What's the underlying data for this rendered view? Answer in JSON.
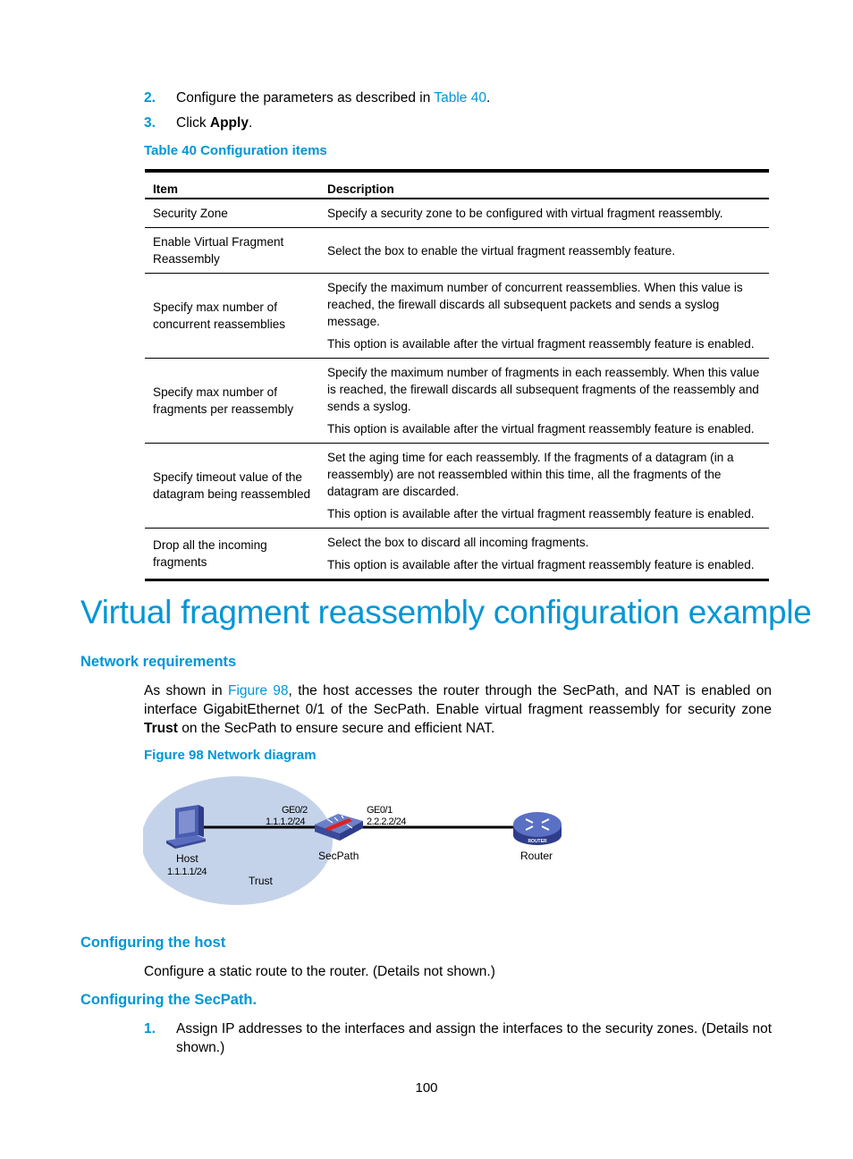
{
  "steps_top": [
    {
      "num": "2.",
      "text_before": "Configure the parameters as described in ",
      "link": "Table 40",
      "text_after": "."
    },
    {
      "num": "3.",
      "text_before": "Click ",
      "bold": "Apply",
      "text_after": "."
    }
  ],
  "table": {
    "caption": "Table 40 Configuration items",
    "headers": [
      "Item",
      "Description"
    ],
    "rows": [
      {
        "item": "Security Zone",
        "desc": [
          "Specify a security zone to be configured with virtual fragment reassembly."
        ]
      },
      {
        "item": "Enable Virtual Fragment Reassembly",
        "desc": [
          "Select the box to enable the virtual fragment reassembly feature."
        ]
      },
      {
        "item": "Specify max number of concurrent reassemblies",
        "desc": [
          "Specify the maximum number of concurrent reassemblies. When this value is reached, the firewall discards all subsequent packets and sends a syslog message.",
          "This option is available after the virtual fragment reassembly feature is enabled."
        ]
      },
      {
        "item": "Specify max number of fragments per reassembly",
        "desc": [
          "Specify the maximum number of fragments in each reassembly. When this value is reached, the firewall discards all subsequent fragments of the reassembly and sends a syslog.",
          "This option is available after the virtual fragment reassembly feature is enabled."
        ]
      },
      {
        "item": "Specify timeout value of the datagram being reassembled",
        "desc": [
          "Set the aging time for each reassembly. If the fragments of a datagram (in a reassembly) are not reassembled within this time, all the fragments of the datagram are discarded.",
          "This option is available after the virtual fragment reassembly feature is enabled."
        ]
      },
      {
        "item": "Drop all the incoming fragments",
        "desc": [
          "Select the box to discard all incoming fragments.",
          "This option is available after the virtual fragment reassembly feature is enabled."
        ]
      }
    ]
  },
  "section_title": "Virtual fragment reassembly configuration example",
  "network_requirements": {
    "heading": "Network requirements",
    "p_before": "As shown in ",
    "p_link": "Figure 98",
    "p_mid": ", the host accesses the router through the SecPath, and NAT is enabled on interface GigabitEthernet 0/1 of the SecPath. Enable virtual fragment reassembly for security zone ",
    "p_bold": "Trust",
    "p_after": " on the SecPath to ensure secure and efficient NAT.",
    "figure_caption": "Figure 98 Network diagram"
  },
  "diagram": {
    "zone_label": "Trust",
    "host": {
      "label": "Host",
      "ip": "1.1.1.1/24"
    },
    "secpath": {
      "label": "SecPath",
      "left_if": "GE0/2",
      "left_ip": "1.1.1.2/24",
      "right_if": "GE0/1",
      "right_ip": "2.2.2.2/24"
    },
    "router": {
      "label": "Router",
      "badge": "ROUTER"
    }
  },
  "configuring_host": {
    "heading": "Configuring the host",
    "text": "Configure a static route to the router. (Details not shown.)"
  },
  "configuring_secpath": {
    "heading": "Configuring the SecPath.",
    "steps": [
      {
        "num": "1.",
        "text": "Assign IP addresses to the interfaces and assign the interfaces to the security zones. (Details not shown.)"
      }
    ]
  },
  "page_number": "100",
  "colors": {
    "accent": "#0096d6",
    "zone_fill": "#c5d3ea",
    "device_blue": "#4a5cb0"
  }
}
